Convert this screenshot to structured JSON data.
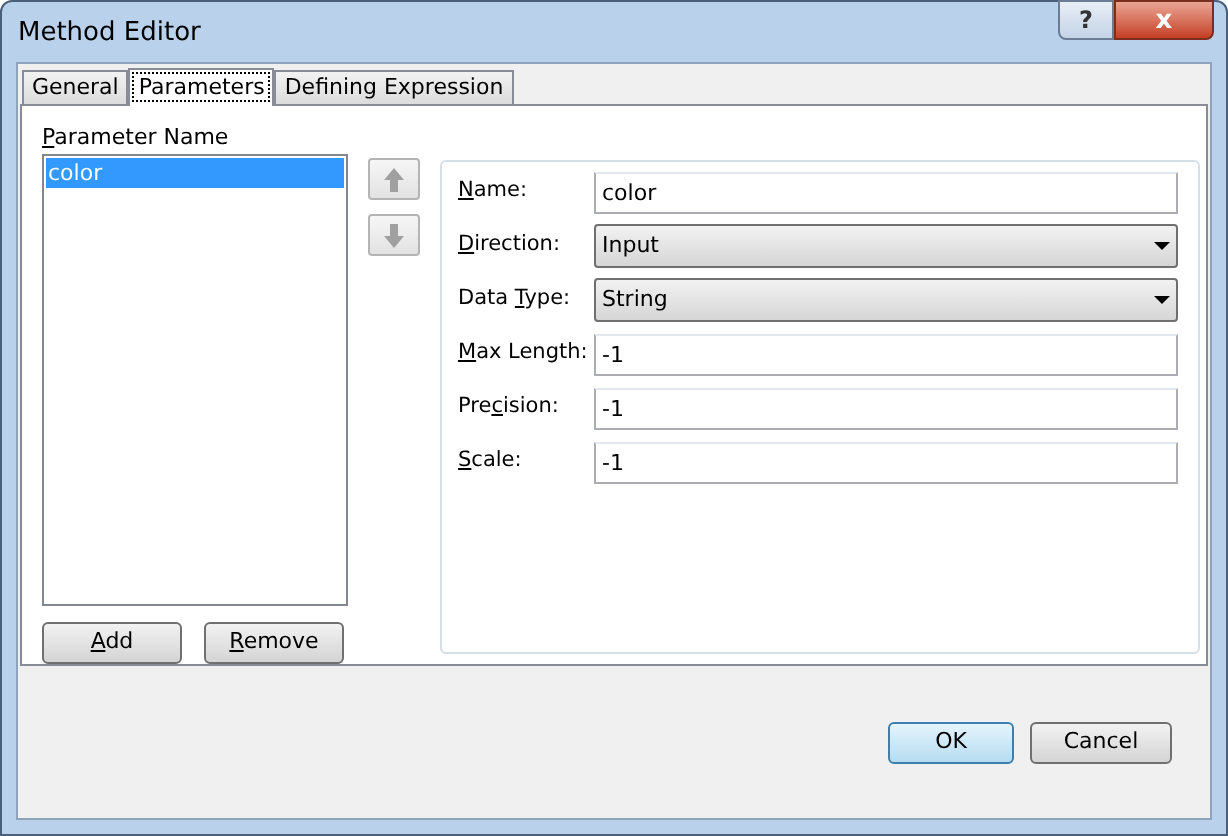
{
  "window": {
    "title": "Method Editor",
    "help_button": "?",
    "close_button": "x"
  },
  "tabs": [
    {
      "label": "General",
      "selected": false
    },
    {
      "label": "Parameters",
      "selected": true
    },
    {
      "label": "Defining Expression",
      "selected": false
    }
  ],
  "parameter_list": {
    "label": {
      "key": "P",
      "after": "arameter Name"
    },
    "items": [
      {
        "text": "color",
        "selected": true
      }
    ]
  },
  "move_buttons": [
    {
      "kind": "up"
    },
    {
      "kind": "down"
    }
  ],
  "fields": [
    {
      "label": {
        "key": "N",
        "after": "ame:"
      },
      "kind": "text",
      "value": "color"
    },
    {
      "label": {
        "key": "D",
        "after": "irection:"
      },
      "kind": "dropdown",
      "value": "Input"
    },
    {
      "label": {
        "before": "Data ",
        "key": "T",
        "after": "ype:"
      },
      "kind": "dropdown",
      "value": "String"
    },
    {
      "label": {
        "key": "M",
        "after": "ax Length:"
      },
      "kind": "text",
      "value": "-1"
    },
    {
      "label": {
        "before": "Pre",
        "key": "c",
        "after": "ision:"
      },
      "kind": "text",
      "value": "-1"
    },
    {
      "label": {
        "key": "S",
        "after": "cale:"
      },
      "kind": "text",
      "value": "-1"
    }
  ],
  "list_buttons": [
    {
      "label": {
        "key": "A",
        "after": "dd"
      }
    },
    {
      "label": {
        "key": "R",
        "after": "emove"
      }
    }
  ],
  "dialog_buttons": [
    {
      "label": "OK",
      "default": true
    },
    {
      "label": "Cancel",
      "default": false
    }
  ]
}
